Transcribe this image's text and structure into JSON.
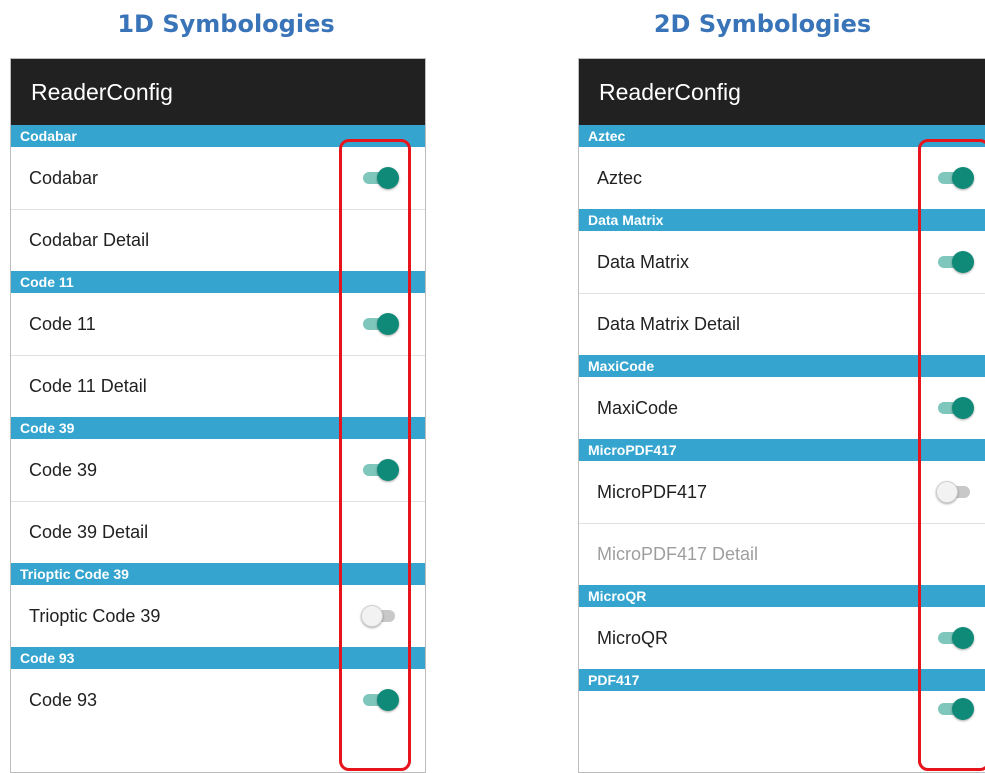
{
  "titles": {
    "left": "1D Symbologies",
    "right": "2D Symbologies"
  },
  "app_title": "ReaderConfig",
  "colors": {
    "appbar": "#212121",
    "section_header": "#35a5cf",
    "toggle_on": "#0f8a78",
    "highlight": "#e8141c",
    "title": "#3a74b8"
  },
  "left_panel": {
    "sections": [
      {
        "header": "Codabar",
        "main": "Codabar",
        "main_on": true,
        "detail": "Codabar Detail"
      },
      {
        "header": "Code 11",
        "main": "Code 11",
        "main_on": true,
        "detail": "Code 11 Detail"
      },
      {
        "header": "Code 39",
        "main": "Code 39",
        "main_on": true,
        "detail": "Code 39 Detail"
      },
      {
        "header": "Trioptic Code 39",
        "main": "Trioptic Code 39",
        "main_on": false
      },
      {
        "header": "Code 93",
        "main": "Code 93",
        "main_on": true
      }
    ]
  },
  "right_panel": {
    "sections": [
      {
        "header": "Aztec",
        "main": "Aztec",
        "main_on": true
      },
      {
        "header": "Data Matrix",
        "main": "Data Matrix",
        "main_on": true,
        "detail": "Data Matrix Detail"
      },
      {
        "header": "MaxiCode",
        "main": "MaxiCode",
        "main_on": true
      },
      {
        "header": "MicroPDF417",
        "main": "MicroPDF417",
        "main_on": false,
        "detail": "MicroPDF417 Detail",
        "detail_disabled": true
      },
      {
        "header": "MicroQR",
        "main": "MicroQR",
        "main_on": true
      },
      {
        "header": "PDF417"
      }
    ]
  }
}
